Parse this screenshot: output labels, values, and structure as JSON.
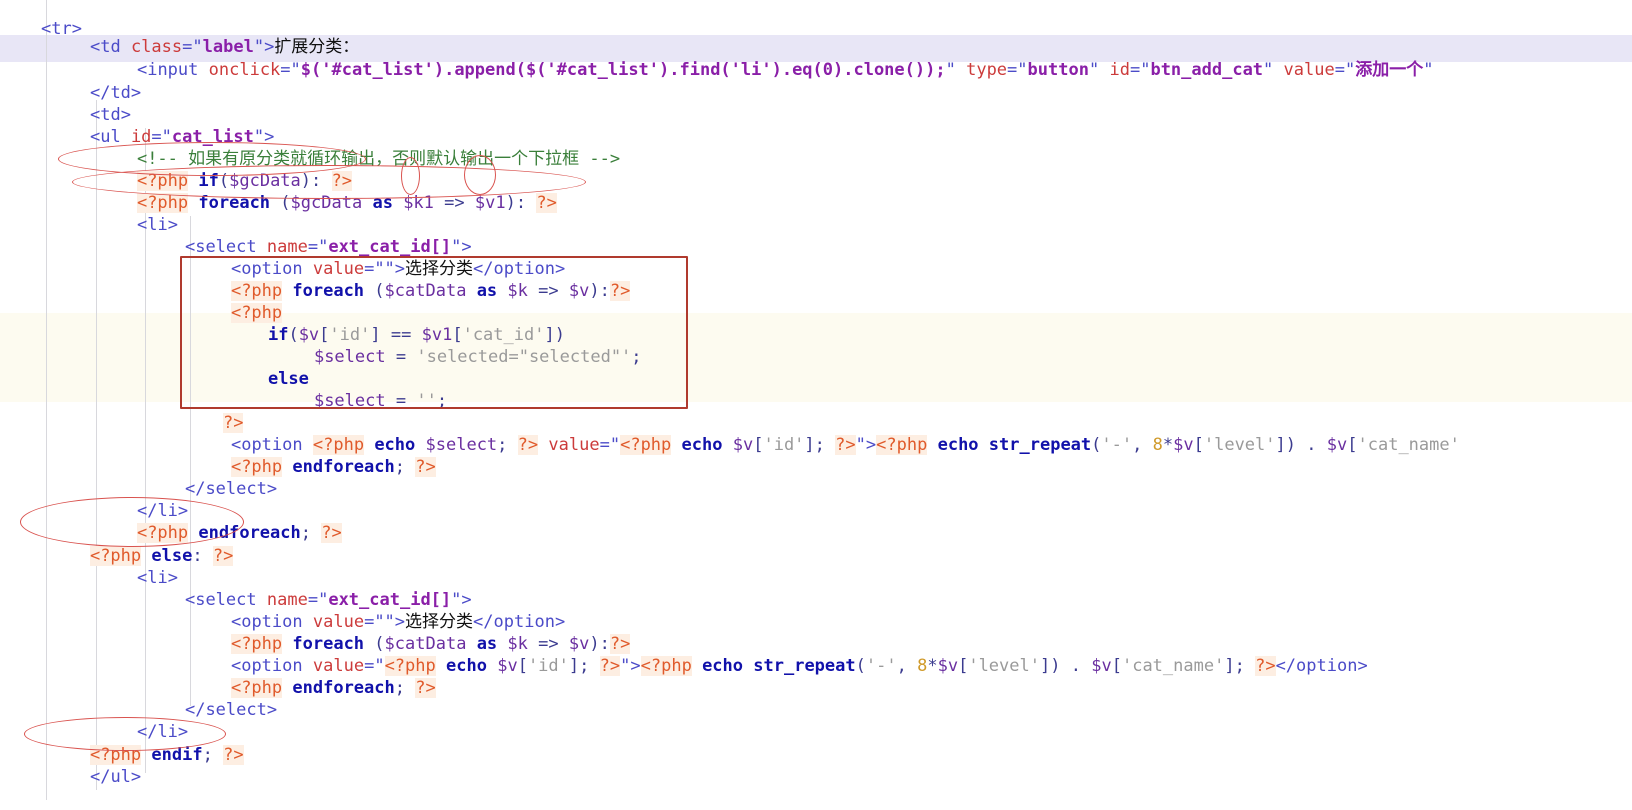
{
  "app": {
    "kind": "code-editor",
    "language": "php-html-template",
    "font_size_px": 17
  },
  "colors": {
    "background": "#ffffff",
    "tag": "#4b4bc8",
    "attribute": "#cc3b3b",
    "attribute_value": "#8a1fa8",
    "html_comment": "#3a7f3a",
    "php_delimiter": "#e05a2b",
    "php_keyword": "#1111aa",
    "php_variable": "#6a2fa0",
    "php_string": "#9a9a9a",
    "php_number": "#d09a2a",
    "annotation_red": "#d9534f",
    "annotation_box": "#b03a2e",
    "current_line_highlight": "#e8e6f6",
    "php_block_band": "#fdfbf0",
    "indent_guide": "#d8d8dd"
  },
  "code": {
    "lines": [
      {
        "n": 1,
        "indent": 0,
        "text": "<tr>"
      },
      {
        "n": 2,
        "indent": 1,
        "text": "<td class=\"label\">扩展分类："
      },
      {
        "n": 3,
        "indent": 2,
        "text": "<input onclick=\"$('#cat_list').append($('#cat_list').find('li').eq(0).clone());\" type=\"button\" id=\"btn_add_cat\" value=\"添加一个\""
      },
      {
        "n": 4,
        "indent": 1,
        "text": "</td>"
      },
      {
        "n": 5,
        "indent": 1,
        "text": "<td>"
      },
      {
        "n": 6,
        "indent": 1,
        "text": "<ul id=\"cat_list\">"
      },
      {
        "n": 7,
        "indent": 2,
        "text": "<!-- 如果有原分类就循环输出，否则默认输出一个下拉框 -->"
      },
      {
        "n": 8,
        "indent": 2,
        "text": "<?php if($gcData): ?>"
      },
      {
        "n": 9,
        "indent": 2,
        "text": "<?php foreach ($gcData as $k1 => $v1): ?>"
      },
      {
        "n": 10,
        "indent": 2,
        "text": "<li>"
      },
      {
        "n": 11,
        "indent": 3,
        "text": "<select name=\"ext_cat_id[]\">"
      },
      {
        "n": 12,
        "indent": 4,
        "text": "<option value=\"\">选择分类</option>"
      },
      {
        "n": 13,
        "indent": 4,
        "text": "<?php foreach ($catData as $k => $v):?>"
      },
      {
        "n": 14,
        "indent": 4,
        "text": "<?php"
      },
      {
        "n": 15,
        "indent": 5,
        "text": "if($v['id'] == $v1['cat_id'])"
      },
      {
        "n": 16,
        "indent": 6,
        "text": "$select = 'selected=\"selected\"';"
      },
      {
        "n": 17,
        "indent": 5,
        "text": "else"
      },
      {
        "n": 18,
        "indent": 6,
        "text": "$select = '';"
      },
      {
        "n": 19,
        "indent": 4,
        "text": "?>"
      },
      {
        "n": 20,
        "indent": 4,
        "text": "<option <?php echo $select; ?> value=\"<?php echo $v['id']; ?>\"><?php echo str_repeat('-', 8*$v['level']) . $v['cat_name'"
      },
      {
        "n": 21,
        "indent": 4,
        "text": "<?php endforeach; ?>"
      },
      {
        "n": 22,
        "indent": 3,
        "text": "</select>"
      },
      {
        "n": 23,
        "indent": 2,
        "text": "</li>"
      },
      {
        "n": 24,
        "indent": 2,
        "text": "<?php endforeach; ?>"
      },
      {
        "n": 25,
        "indent": 1,
        "text": "<?php else: ?>"
      },
      {
        "n": 26,
        "indent": 2,
        "text": "<li>"
      },
      {
        "n": 27,
        "indent": 3,
        "text": "<select name=\"ext_cat_id[]\">"
      },
      {
        "n": 28,
        "indent": 4,
        "text": "<option value=\"\">选择分类</option>"
      },
      {
        "n": 29,
        "indent": 4,
        "text": "<?php foreach ($catData as $k => $v):?>"
      },
      {
        "n": 30,
        "indent": 4,
        "text": "<option value=\"<?php echo $v['id']; ?>\"><?php echo str_repeat('-', 8*$v['level']) . $v['cat_name']; ?></option>"
      },
      {
        "n": 31,
        "indent": 4,
        "text": "<?php endforeach; ?>"
      },
      {
        "n": 32,
        "indent": 3,
        "text": "</select>"
      },
      {
        "n": 33,
        "indent": 2,
        "text": "</li>"
      },
      {
        "n": 34,
        "indent": 1,
        "text": "<?php endif; ?>"
      },
      {
        "n": 35,
        "indent": 1,
        "text": "</ul>"
      }
    ]
  },
  "annotations": {
    "box": {
      "label": "php-select-logic-box"
    },
    "ellipses": [
      {
        "label": "ellipse-php-if-gcdata"
      },
      {
        "label": "ellipse-php-foreach-gcdata"
      },
      {
        "label": "ellipse-var-k1"
      },
      {
        "label": "ellipse-var-v1"
      },
      {
        "label": "ellipse-php-endforeach-else"
      },
      {
        "label": "ellipse-php-endif"
      }
    ]
  }
}
